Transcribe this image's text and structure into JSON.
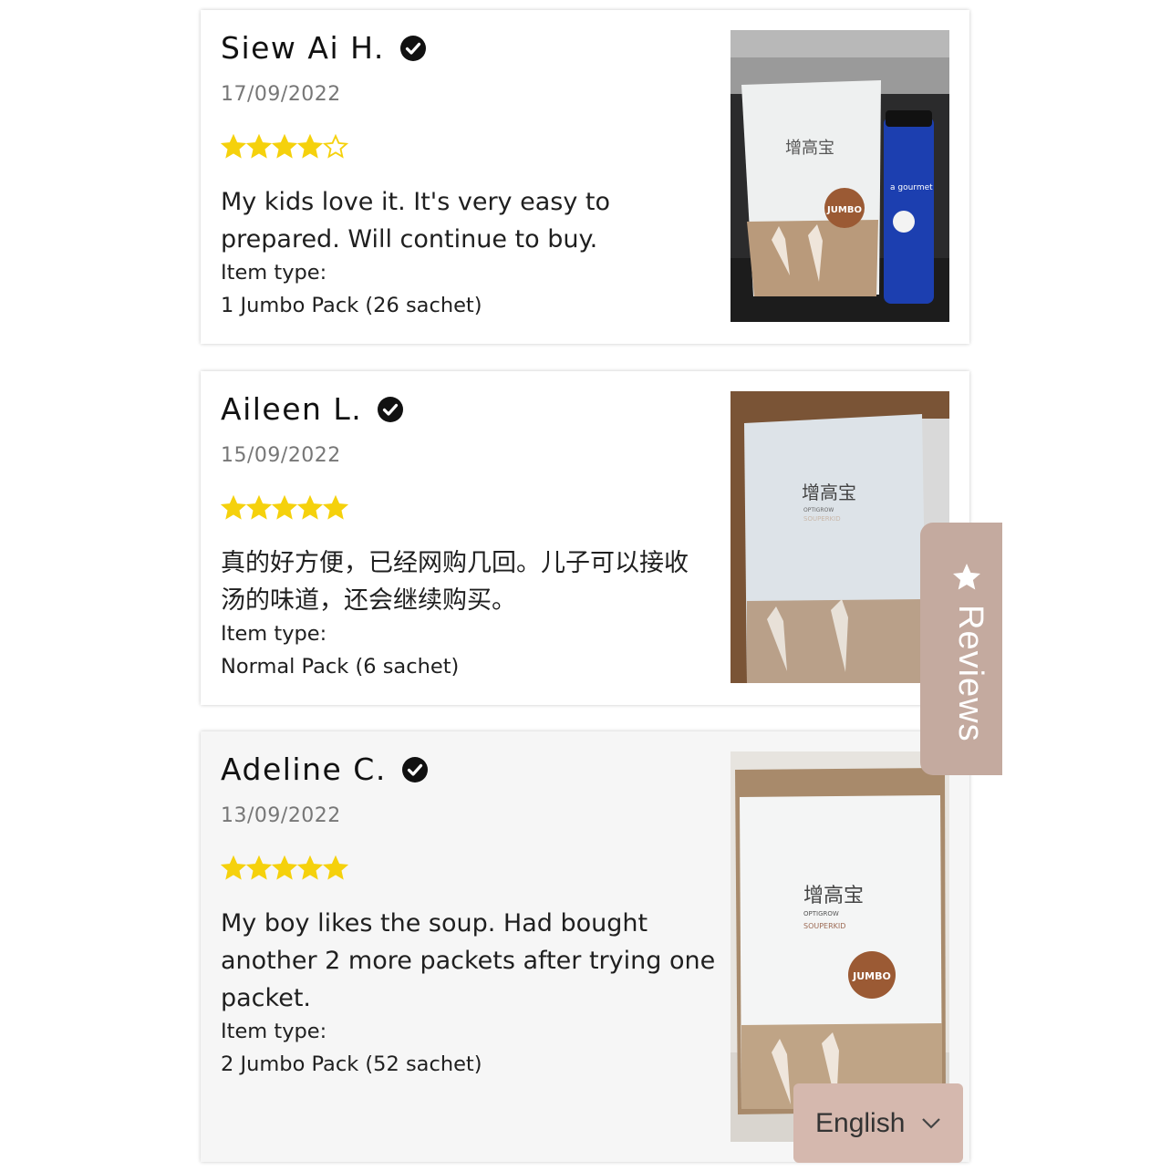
{
  "reviews": [
    {
      "name": "Siew Ai H.",
      "date": "17/09/2022",
      "rating": 4,
      "body": "My kids love it. It's very easy to prepared. Will continue to buy.",
      "item_type_label": "Item type:",
      "item_type_value": "1 Jumbo Pack (26 sachet)",
      "photo_pack_cn": "增高宝",
      "photo_badge": "JUMBO",
      "photo_bottle_text": "a gourmet"
    },
    {
      "name": "Aileen L.",
      "date": "15/09/2022",
      "rating": 5,
      "body": "真的好方便，已经网购几回。儿子可以接收汤的味道，还会继续购买。",
      "item_type_label": "Item type:",
      "item_type_value": "Normal Pack (6 sachet)",
      "photo_pack_cn": "增高宝",
      "photo_brand": "OPTIGROW",
      "photo_sub": "SOUPERKID"
    },
    {
      "name": "Adeline C.",
      "date": "13/09/2022",
      "rating": 5,
      "body": "My boy likes the soup. Had bought another 2 more packets after trying one packet.",
      "item_type_label": "Item type:",
      "item_type_value": "2 Jumbo Pack (52 sachet)",
      "photo_pack_cn": "增高宝",
      "photo_brand": "OPTIGROW",
      "photo_sub": "SOUPERKID",
      "photo_badge": "JUMBO"
    }
  ],
  "reviews_tab": {
    "label": "Reviews",
    "icon": "star-icon"
  },
  "language_selector": {
    "value": "English",
    "icon": "chevron-down-icon"
  },
  "colors": {
    "star": "#f5d10c",
    "tab": "#c4aa9f",
    "lang": "#d5b8ae"
  }
}
